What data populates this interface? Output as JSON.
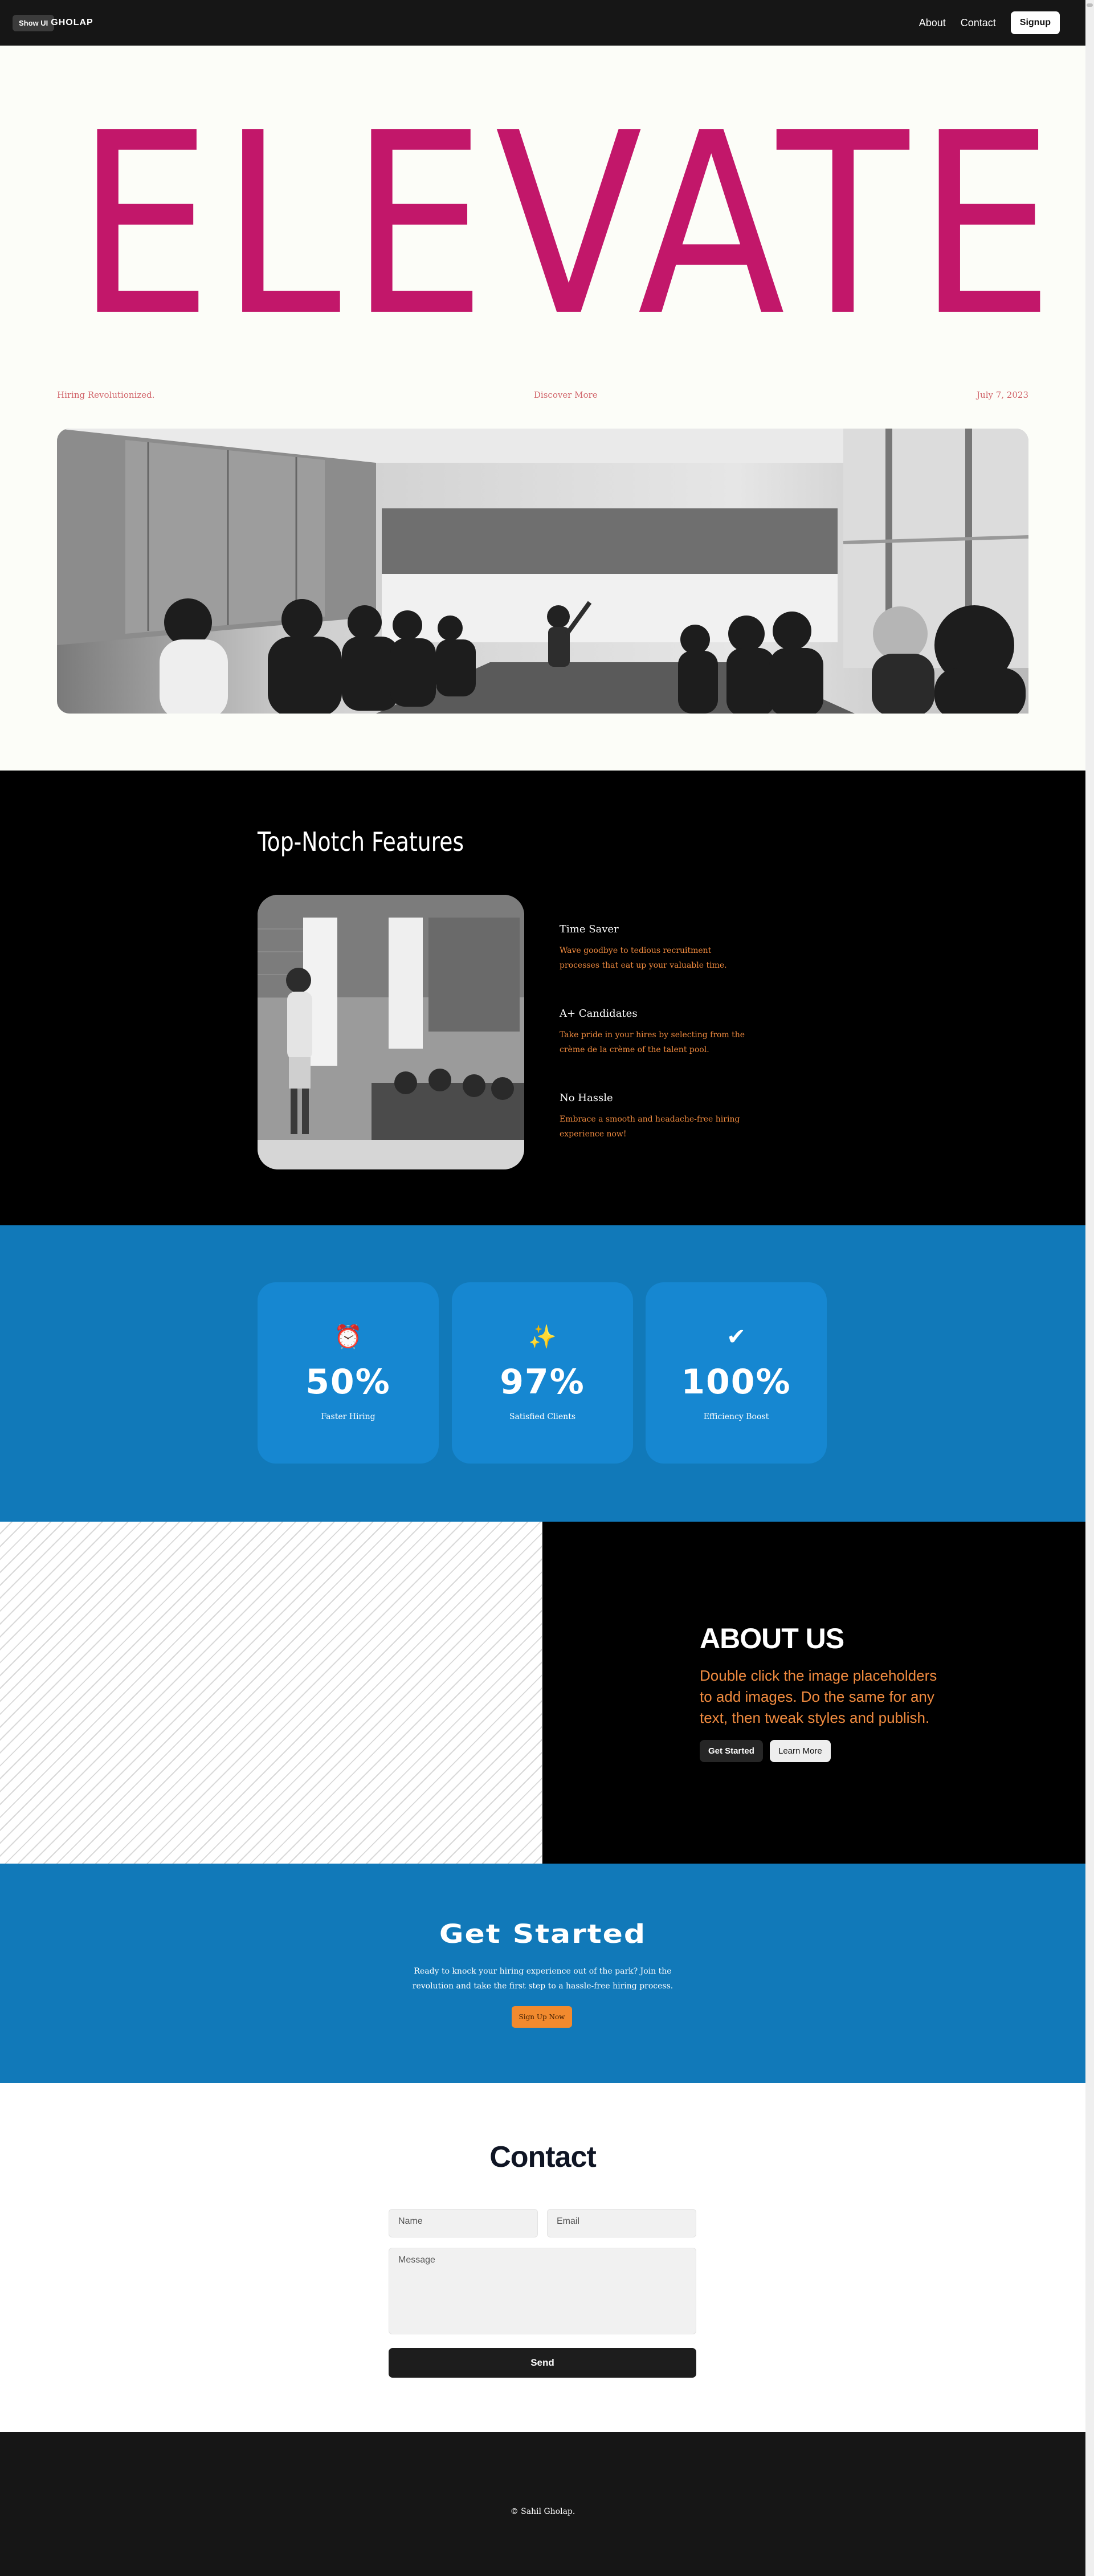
{
  "nav": {
    "show_ui_label": "Show UI",
    "logo": "GHOLAP",
    "links": [
      "About",
      "Contact"
    ],
    "signup_label": "Signup"
  },
  "hero": {
    "title": "ELEVATE",
    "meta_left": "Hiring Revolutionized.",
    "meta_center": "Discover More",
    "meta_right": "July 7, 2023"
  },
  "features": {
    "title": "Top-Notch Features",
    "items": [
      {
        "title": "Time Saver",
        "text": "Wave goodbye to tedious recruitment processes that eat up your valuable time."
      },
      {
        "title": "A+ Candidates",
        "text": "Take pride in your hires by selecting from the crème de la crème of the talent pool."
      },
      {
        "title": "No Hassle",
        "text": "Embrace a smooth and headache-free hiring experience now!"
      }
    ]
  },
  "stats": [
    {
      "icon": "alarm-clock-icon",
      "glyph": "⏰",
      "value": "50%",
      "label": "Faster Hiring"
    },
    {
      "icon": "sparkle-icon",
      "glyph": "✨",
      "value": "97%",
      "label": "Satisfied Clients"
    },
    {
      "icon": "checkmark-icon",
      "glyph": "✔",
      "value": "100%",
      "label": "Efficiency Boost"
    }
  ],
  "about": {
    "title": "ABOUT US",
    "text": "Double click the image placeholders to add images. Do the same for any text, then tweak styles and publish.",
    "primary_label": "Get Started",
    "secondary_label": "Learn More"
  },
  "get_started": {
    "title": "Get Started",
    "text": "Ready to knock your hiring experience out of the park? Join the revolution and take the first step to a hassle-free hiring process.",
    "button_label": "Sign Up Now"
  },
  "contact": {
    "title": "Contact",
    "name_placeholder": "Name",
    "email_placeholder": "Email",
    "message_placeholder": "Message",
    "send_label": "Send"
  },
  "footer": {
    "copyright": "© Sahil Gholap."
  },
  "colors": {
    "brand_magenta": "#c2176a",
    "accent_orange": "#ef8a3f",
    "primary_blue": "#1179b9"
  }
}
